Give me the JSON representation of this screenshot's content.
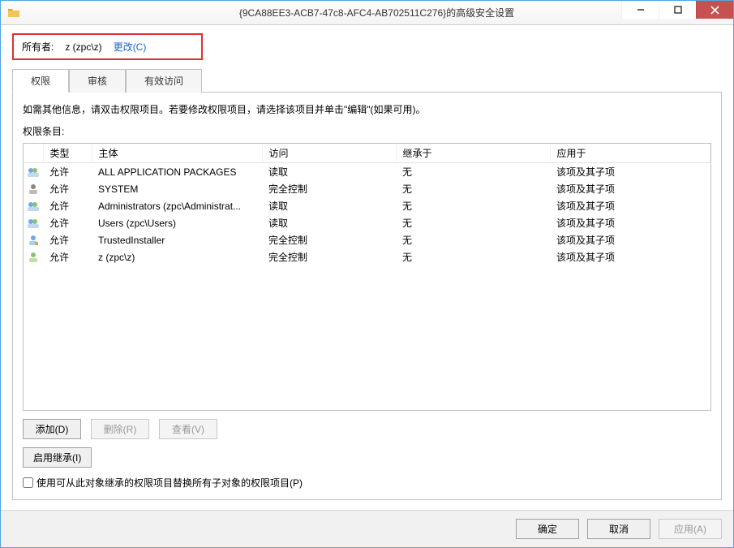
{
  "titlebar": {
    "title": "{9CA88EE3-ACB7-47c8-AFC4-AB702511C276}的高级安全设置"
  },
  "owner": {
    "label": "所有者:",
    "value": "z (zpc\\z)",
    "change_link": "更改(C)"
  },
  "tabs": [
    {
      "label": "权限",
      "active": true
    },
    {
      "label": "审核",
      "active": false
    },
    {
      "label": "有效访问",
      "active": false
    }
  ],
  "instructions": "如需其他信息，请双击权限项目。若要修改权限项目，请选择该项目并单击\"编辑\"(如果可用)。",
  "entries_label": "权限条目:",
  "columns": {
    "type": "类型",
    "principal": "主体",
    "access": "访问",
    "inherited_from": "继承于",
    "applies_to": "应用于"
  },
  "rows": [
    {
      "icon": "group-package",
      "type": "允许",
      "principal": "ALL APPLICATION PACKAGES",
      "access": "读取",
      "inherited_from": "无",
      "applies_to": "该项及其子项"
    },
    {
      "icon": "user-system",
      "type": "允许",
      "principal": "SYSTEM",
      "access": "完全控制",
      "inherited_from": "无",
      "applies_to": "该项及其子项"
    },
    {
      "icon": "group",
      "type": "允许",
      "principal": "Administrators (zpc\\Administrat...",
      "access": "读取",
      "inherited_from": "无",
      "applies_to": "该项及其子项"
    },
    {
      "icon": "group",
      "type": "允许",
      "principal": "Users (zpc\\Users)",
      "access": "读取",
      "inherited_from": "无",
      "applies_to": "该项及其子项"
    },
    {
      "icon": "user-installer",
      "type": "允许",
      "principal": "TrustedInstaller",
      "access": "完全控制",
      "inherited_from": "无",
      "applies_to": "该项及其子项"
    },
    {
      "icon": "user",
      "type": "允许",
      "principal": "z (zpc\\z)",
      "access": "完全控制",
      "inherited_from": "无",
      "applies_to": "该项及其子项"
    }
  ],
  "buttons": {
    "add": "添加(D)",
    "remove": "删除(R)",
    "view": "查看(V)",
    "enable_inherit": "启用继承(I)",
    "ok": "确定",
    "cancel": "取消",
    "apply": "应用(A)"
  },
  "checkbox": {
    "label": "使用可从此对象继承的权限项目替换所有子对象的权限项目(P)"
  }
}
